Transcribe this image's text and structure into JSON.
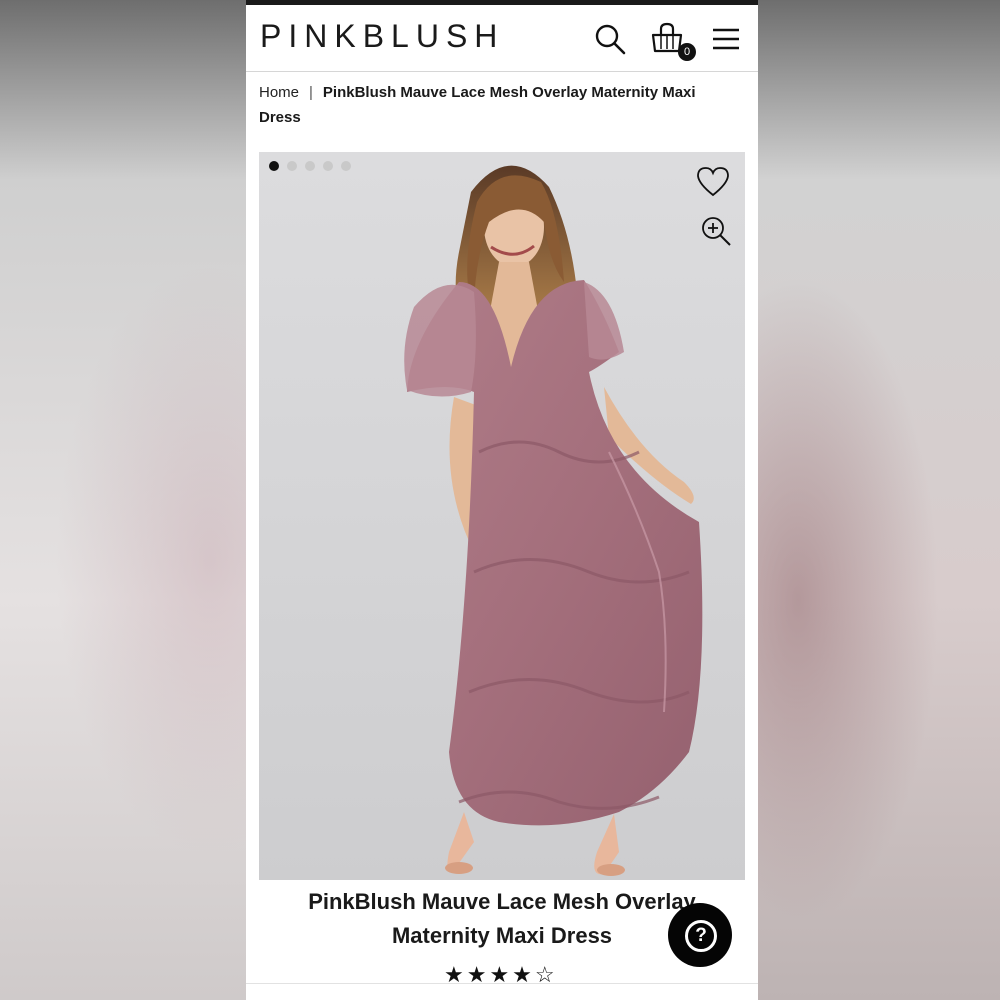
{
  "header": {
    "logo": "PINKBLUSH",
    "search_icon": "search-icon",
    "cart_icon": "shopping-bag-icon",
    "cart_count": "0",
    "menu_icon": "hamburger-menu-icon"
  },
  "breadcrumb": {
    "home": "Home",
    "separator": "|",
    "current": "PinkBlush Mauve Lace Mesh Overlay Maternity Maxi Dress"
  },
  "gallery": {
    "image_count": 5,
    "active_index": 0,
    "wishlist_icon": "heart-icon",
    "zoom_icon": "zoom-in-icon",
    "photo_subject": "product-photo"
  },
  "product": {
    "title_line1": "PinkBlush Mauve Lace Mesh Overlay",
    "title_line2": "Maternity Maxi Dress",
    "rating_stars": "★★★★☆",
    "rating_value": 4.5
  },
  "help": {
    "label": "?",
    "icon": "help-icon"
  },
  "colors": {
    "text": "#1a1a1a",
    "dress": "#a8727f",
    "background": "#d8d8da"
  }
}
